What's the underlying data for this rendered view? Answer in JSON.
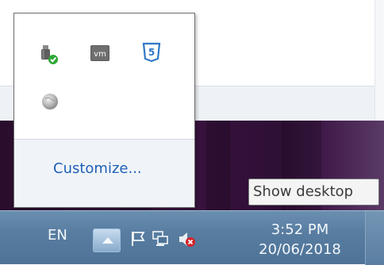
{
  "flyout": {
    "customize_label": "Customize...",
    "icons": [
      "usb-safely-remove-icon",
      "vmware-icon",
      "html5-shield-icon",
      "globe-icon"
    ],
    "vmware_text": "vm",
    "html5_text": "5"
  },
  "tooltip": {
    "text": "Show desktop"
  },
  "taskbar": {
    "language": "EN",
    "time": "3:52 PM",
    "date": "20/06/2018",
    "icons": [
      "show-hidden-icons-arrow",
      "action-center-flag-icon",
      "network-icon",
      "volume-muted-icon"
    ]
  },
  "colors": {
    "taskbar": "#587da1",
    "link": "#1f5fb5",
    "desktop": "#3a1340"
  }
}
